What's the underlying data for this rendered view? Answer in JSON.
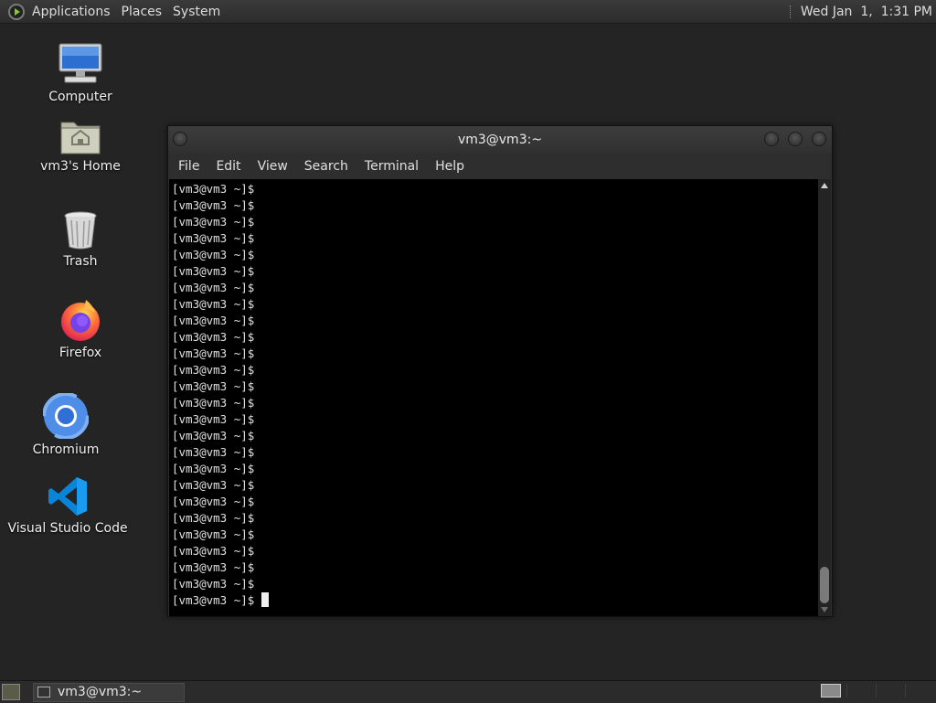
{
  "top_panel": {
    "menus": [
      "Applications",
      "Places",
      "System"
    ],
    "clock": "Wed Jan  1,  1:31 PM"
  },
  "desktop_icons": [
    {
      "label": "Computer",
      "icon": "computer-icon"
    },
    {
      "label": "vm3's Home",
      "icon": "home-folder-icon"
    },
    {
      "label": "Trash",
      "icon": "trash-icon"
    },
    {
      "label": "Firefox",
      "icon": "firefox-icon"
    },
    {
      "label": "Chromium",
      "icon": "chromium-icon"
    },
    {
      "label": "Visual Studio Code",
      "icon": "vscode-icon"
    }
  ],
  "terminal": {
    "title": "vm3@vm3:~",
    "menu": [
      "File",
      "Edit",
      "View",
      "Search",
      "Terminal",
      "Help"
    ],
    "prompt": "[vm3@vm3 ~]$",
    "line_count": 26
  },
  "taskbar": {
    "window_button_label": "vm3@vm3:~",
    "workspaces": 4,
    "active_workspace": 1
  },
  "colors": {
    "desktop_bg": "#242424",
    "terminal_bg": "#000000",
    "panel_bg": "#2c2c2c",
    "firefox_orange": "#ff7139",
    "chromium_blue": "#4e8ee8",
    "vscode_blue": "#0a84d6"
  }
}
